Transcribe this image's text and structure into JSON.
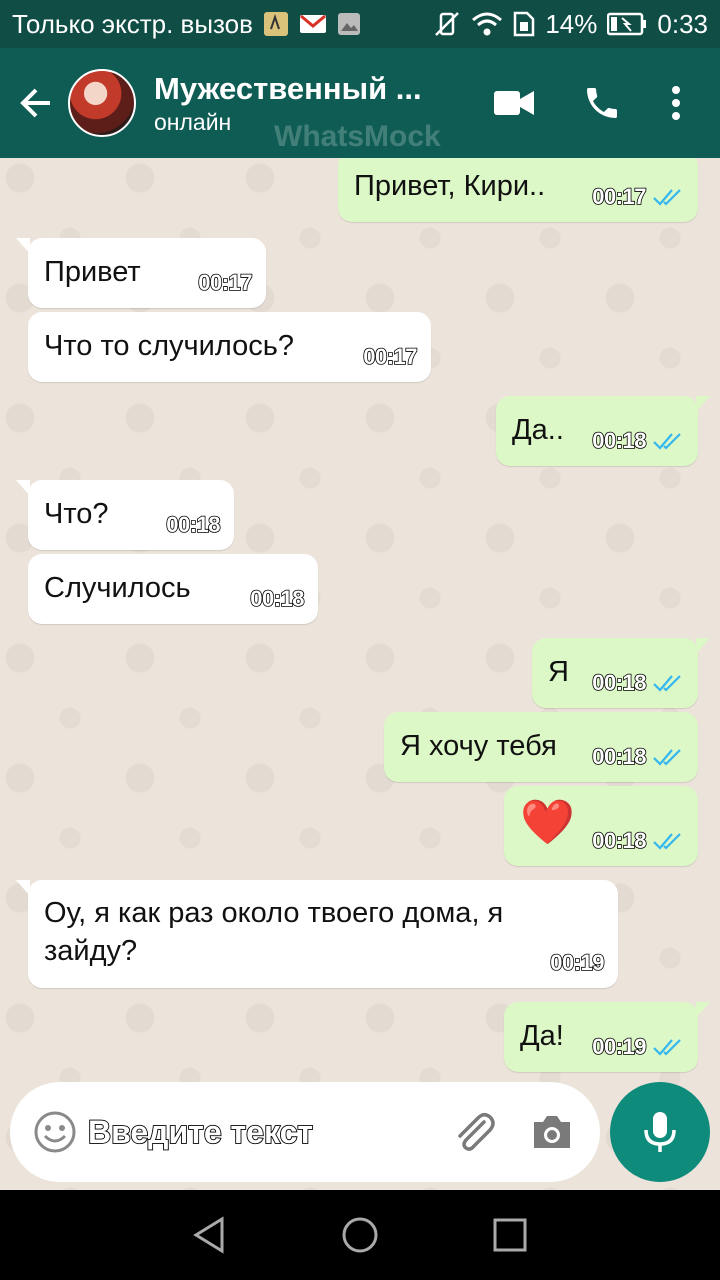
{
  "status_bar": {
    "carrier_text": "Только экстр. вызов",
    "battery": "14%",
    "time": "0:33"
  },
  "header": {
    "contact_name": "Мужественный ...",
    "contact_status": "онлайн",
    "watermark": "WhatsMock"
  },
  "messages": [
    {
      "dir": "out",
      "text": "Привет, Кири..",
      "time": "00:17"
    },
    {
      "dir": "in",
      "text": "Привет",
      "time": "00:17"
    },
    {
      "dir": "in",
      "text": "Что то случилось?",
      "time": "00:17"
    },
    {
      "dir": "out",
      "text": "Да..",
      "time": "00:18"
    },
    {
      "dir": "in",
      "text": "Что?",
      "time": "00:18"
    },
    {
      "dir": "in",
      "text": "Случилось",
      "time": "00:18"
    },
    {
      "dir": "out",
      "text": "Я",
      "time": "00:18"
    },
    {
      "dir": "out",
      "text": "Я хочу тебя",
      "time": "00:18"
    },
    {
      "dir": "out",
      "text": "❤️",
      "time": "00:18"
    },
    {
      "dir": "in",
      "text": "Оу, я как раз около твоего дома, я зайду?",
      "time": "00:19"
    },
    {
      "dir": "out",
      "text": "Да!",
      "time": "00:19"
    }
  ],
  "composer": {
    "placeholder": "Введите текст"
  },
  "colors": {
    "header": "#0f5c54",
    "outgoing_bubble": "#dcf8c6",
    "incoming_bubble": "#ffffff",
    "read_ticks": "#34b7f1",
    "mic_button": "#0f8b7b"
  },
  "icons": [
    "back-arrow-icon",
    "video-call-icon",
    "phone-icon",
    "more-vert-icon",
    "emoji-icon",
    "attach-icon",
    "camera-icon",
    "mic-icon",
    "double-check-icon"
  ]
}
